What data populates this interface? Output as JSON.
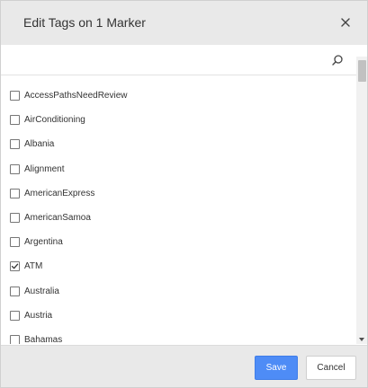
{
  "dialog": {
    "title": "Edit Tags on 1 Marker"
  },
  "search": {
    "value": "",
    "placeholder": ""
  },
  "tags": [
    {
      "label": "AccessPathsNeedReview",
      "checked": false
    },
    {
      "label": "AirConditioning",
      "checked": false
    },
    {
      "label": "Albania",
      "checked": false
    },
    {
      "label": "Alignment",
      "checked": false
    },
    {
      "label": "AmericanExpress",
      "checked": false
    },
    {
      "label": "AmericanSamoa",
      "checked": false
    },
    {
      "label": "Argentina",
      "checked": false
    },
    {
      "label": "ATM",
      "checked": true
    },
    {
      "label": "Australia",
      "checked": false
    },
    {
      "label": "Austria",
      "checked": false
    },
    {
      "label": "Bahamas",
      "checked": false
    }
  ],
  "footer": {
    "save_label": "Save",
    "cancel_label": "Cancel"
  },
  "colors": {
    "primary": "#4e8cf6",
    "header_bg": "#e9e9e9"
  }
}
